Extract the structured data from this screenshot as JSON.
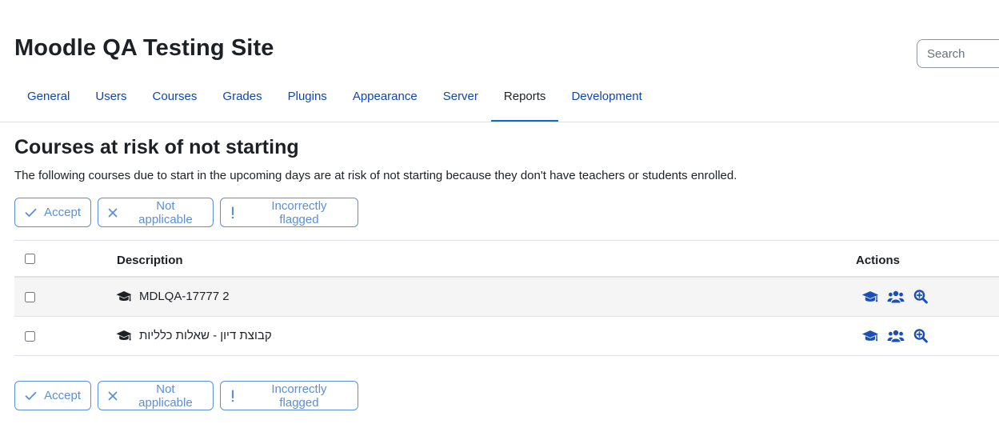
{
  "header": {
    "site_title": "Moodle QA Testing Site",
    "search_placeholder": "Search"
  },
  "nav": {
    "tabs": [
      {
        "label": "General"
      },
      {
        "label": "Users"
      },
      {
        "label": "Courses"
      },
      {
        "label": "Grades"
      },
      {
        "label": "Plugins"
      },
      {
        "label": "Appearance"
      },
      {
        "label": "Server"
      },
      {
        "label": "Reports",
        "active": true
      },
      {
        "label": "Development"
      }
    ]
  },
  "main": {
    "heading": "Courses at risk of not starting",
    "description": "The following courses due to start in the upcoming days are at risk of not starting because they don't have teachers or students enrolled.",
    "bulk_actions": {
      "accept": "Accept",
      "not_applicable": "Not applicable",
      "incorrectly_flagged": "Incorrectly flagged"
    },
    "table": {
      "columns": {
        "description": "Description",
        "actions": "Actions"
      },
      "rows": [
        {
          "course": "MDLQA-17777 2"
        },
        {
          "course": "קבוצת דיון - שאלות כלליות"
        }
      ]
    }
  },
  "colors": {
    "link": "#0f47ad",
    "accent": "#0f6cbf",
    "action_icon": "#1b4fb8",
    "button_outline": "#5b8fd6"
  },
  "icons": {
    "accept": "check-icon",
    "not_applicable": "times-icon",
    "incorrectly_flagged": "exclamation-icon",
    "course": "graduation-cap-icon",
    "participants": "users-icon",
    "insights": "search-plus-icon"
  }
}
